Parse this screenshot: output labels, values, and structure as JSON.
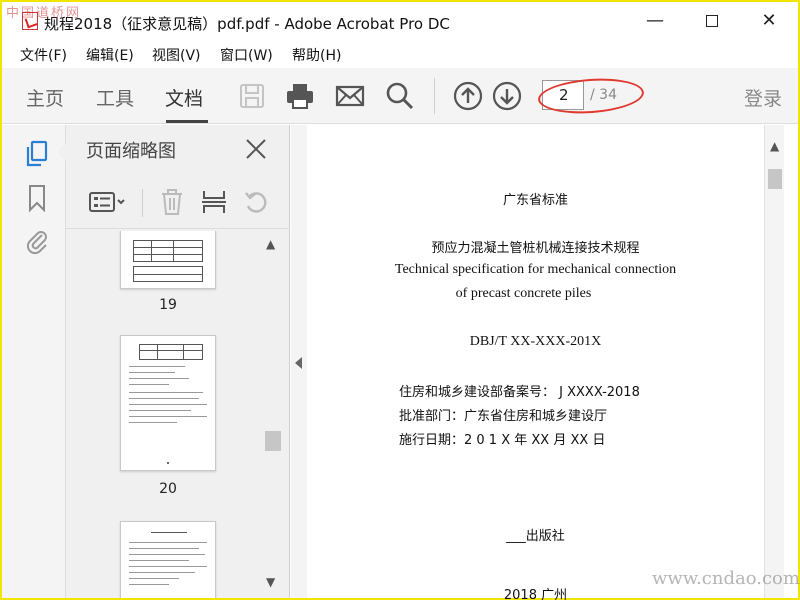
{
  "window": {
    "title": "规程2018（征求意见稿）pdf.pdf - Adobe Acrobat Pro DC",
    "minimize": "—",
    "close": "✕"
  },
  "watermarks": {
    "top_left": "中国道桥网",
    "bottom_right": "www.cndao.com"
  },
  "menu": [
    "文件(F)",
    "编辑(E)",
    "视图(V)",
    "窗口(W)",
    "帮助(H)"
  ],
  "toolbar": {
    "tabs": [
      {
        "label": "主页",
        "active": false
      },
      {
        "label": "工具",
        "active": false
      },
      {
        "label": "文档",
        "active": true
      }
    ],
    "icons": [
      "save-icon",
      "print-icon",
      "email-icon",
      "search-icon",
      "page-up-icon",
      "page-down-icon"
    ],
    "page_current": "2",
    "page_total": "/ 34",
    "login_label": "登录"
  },
  "rail": {
    "icons": [
      "page-thumbnails-icon",
      "bookmark-icon",
      "attachment-icon"
    ]
  },
  "thumbnail_panel": {
    "title": "页面缩略图",
    "tools": [
      "options-menu-icon",
      "delete-page-icon",
      "insert-page-icon",
      "undo-icon"
    ],
    "pages": [
      {
        "number": "19"
      },
      {
        "number": "20"
      },
      {
        "number": ""
      }
    ]
  },
  "document": {
    "lines": [
      {
        "text": "广东省标准",
        "kind": "cn"
      },
      {
        "text": "预应力混凝土管桩机械连接技术规程",
        "kind": "cn"
      },
      {
        "text": "Technical specification for mechanical connection",
        "kind": "en"
      },
      {
        "text": "of    precast concrete piles",
        "kind": "en"
      },
      {
        "text": "DBJ/T XX-XXX-201X",
        "kind": "en"
      },
      {
        "text": "住房和城乡建设部备案号：   J XXXX-2018",
        "kind": "cn-left"
      },
      {
        "text": "批准部门：广东省住房和城乡建设厅",
        "kind": "cn-left"
      },
      {
        "text": "施行日期：2 0 1 X  年   XX  月   XX  日",
        "kind": "cn-left"
      },
      {
        "text": "___出版社",
        "kind": "cn"
      },
      {
        "text": "2018 广州",
        "kind": "cn"
      }
    ]
  },
  "colors": {
    "frame": "#f2e600",
    "highlight_ellipse": "#e03a30",
    "toolbar_bg": "#f4f4f4"
  }
}
